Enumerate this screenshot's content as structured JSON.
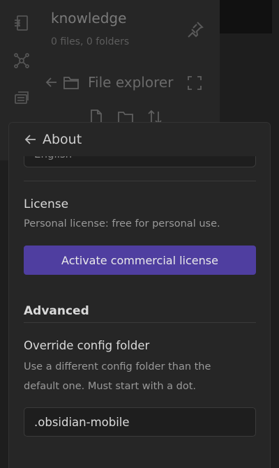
{
  "workspace": {
    "vault_name": "knowledge",
    "vault_stats": "0 files, 0 folders",
    "explorer_title": "File explorer"
  },
  "modal": {
    "title": "About",
    "language_value_partial": "English",
    "license": {
      "label": "License",
      "description": "Personal license: free for personal use.",
      "button_label": "Activate commercial license"
    },
    "advanced": {
      "heading": "Advanced",
      "override_label": "Override config folder",
      "override_description": "Use a different config folder than the default one. Must start with a dot.",
      "config_folder_value": ".obsidian-mobile"
    }
  },
  "colors": {
    "accent": "#4f3ea0",
    "background": "#1e1e1e",
    "panel": "#262626"
  }
}
